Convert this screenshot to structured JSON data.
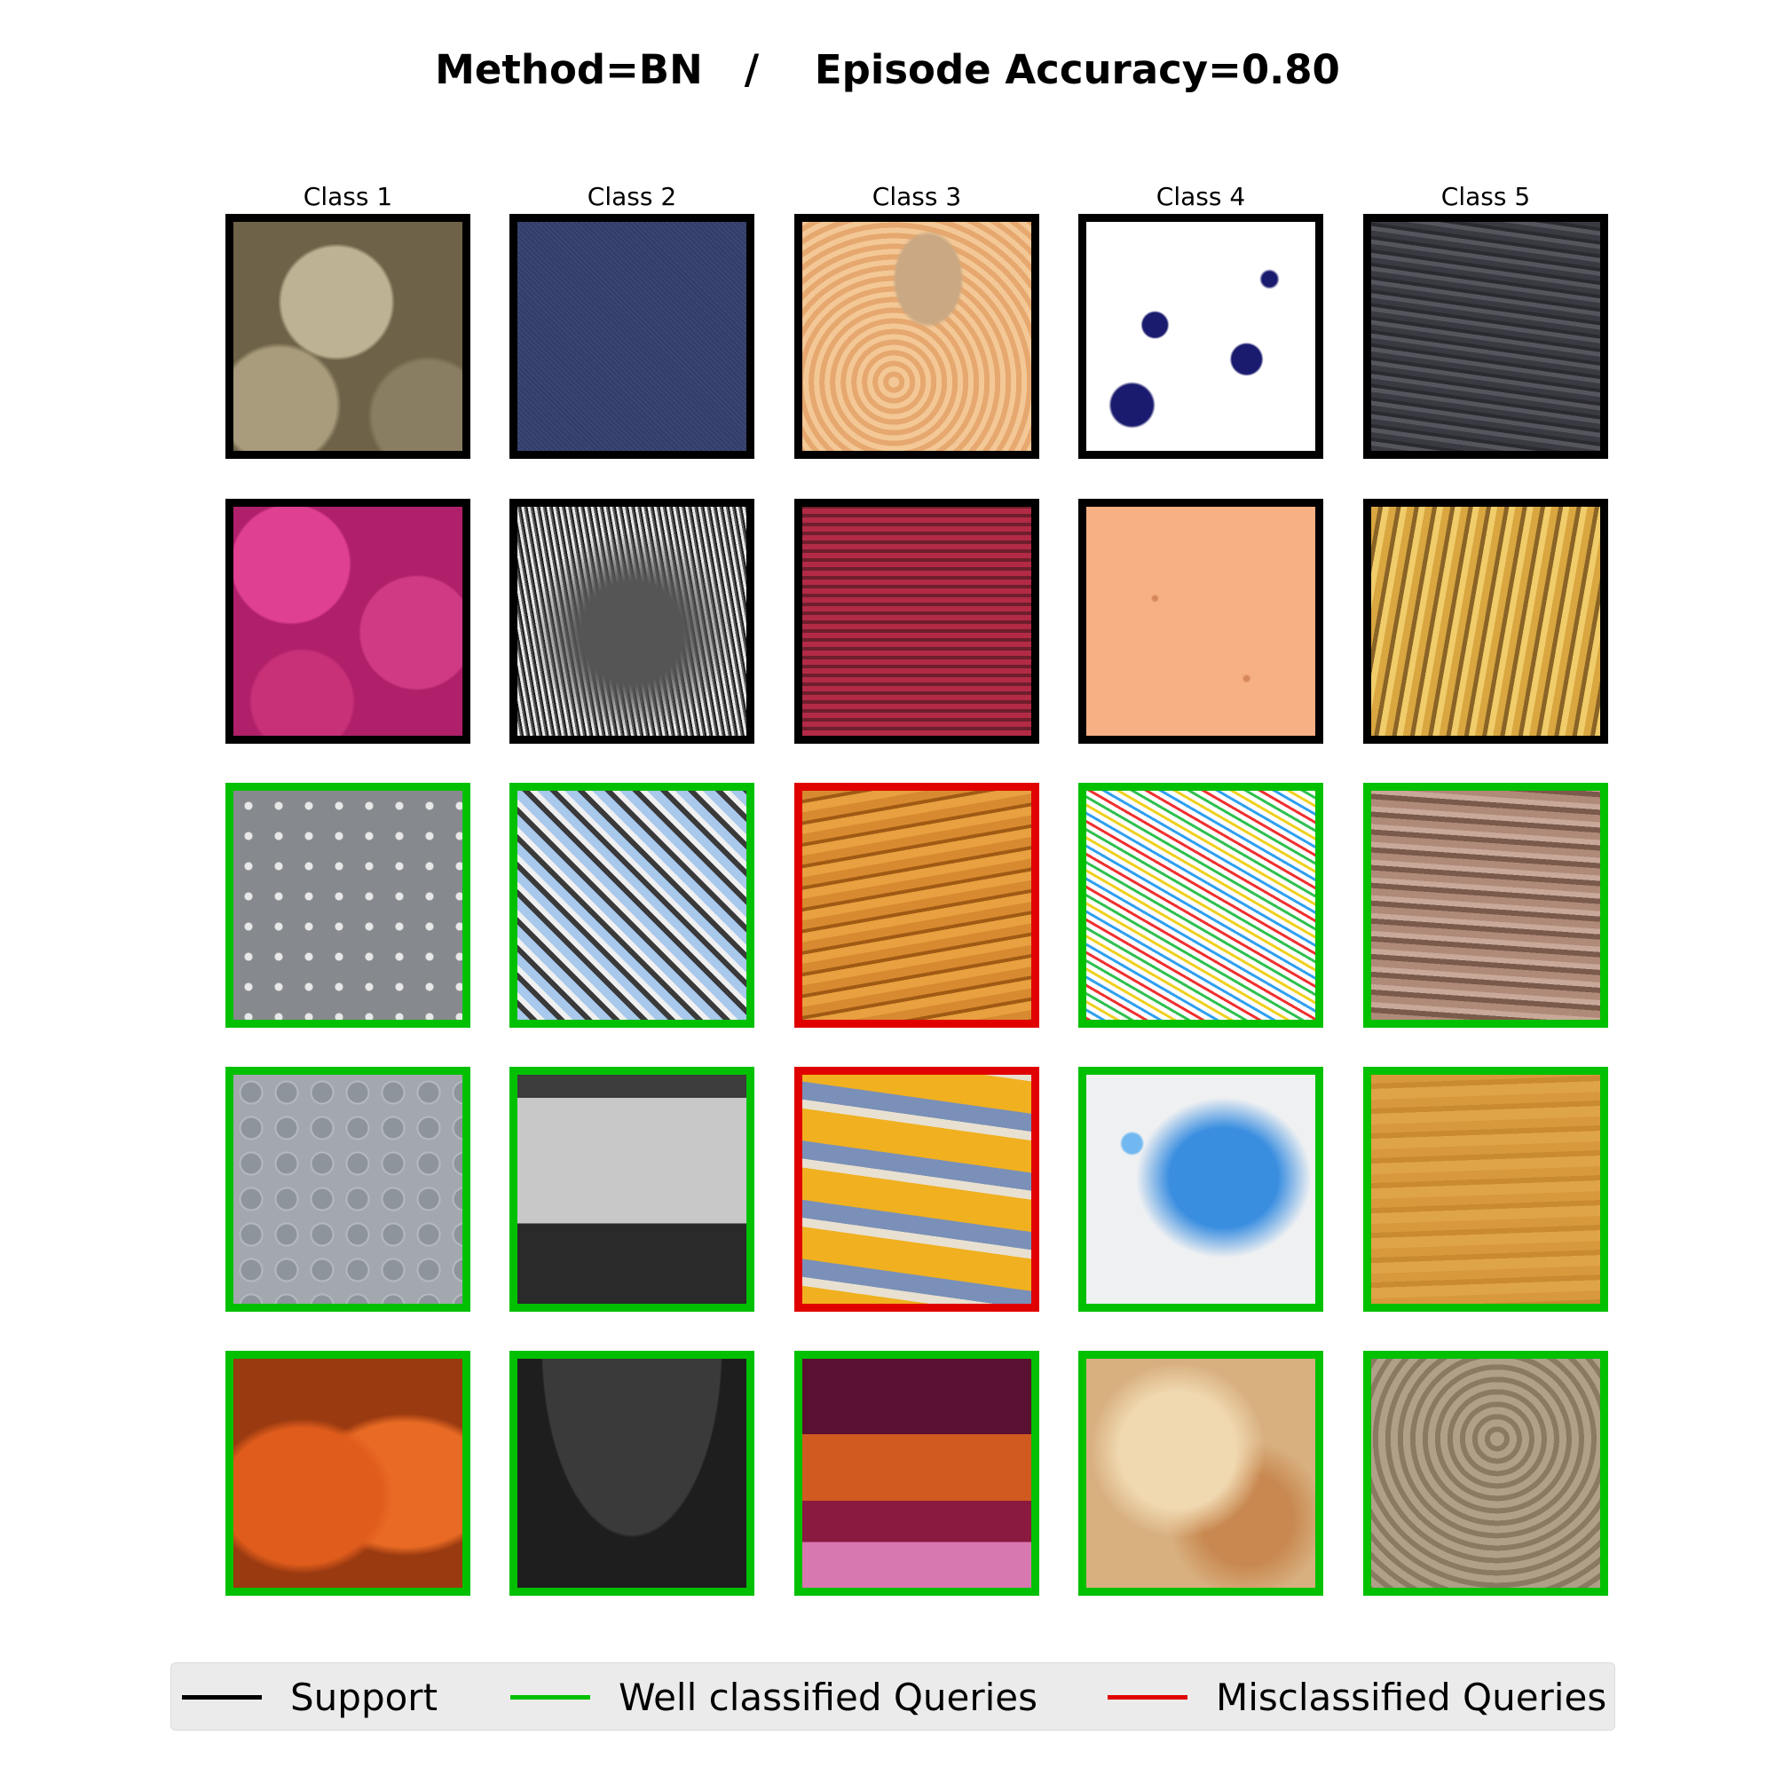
{
  "title": "Method=BN   /    Episode Accuracy=0.80",
  "columns": [
    "Class 1",
    "Class 2",
    "Class 3",
    "Class 4",
    "Class 5"
  ],
  "colors": {
    "support": "#000000",
    "well": "#00c000",
    "mis": "#e00000"
  },
  "rows": [
    {
      "role": "support",
      "status": [
        "support",
        "support",
        "support",
        "support",
        "support"
      ]
    },
    {
      "role": "support",
      "status": [
        "support",
        "support",
        "support",
        "support",
        "support"
      ]
    },
    {
      "role": "query",
      "status": [
        "well",
        "well",
        "mis",
        "well",
        "well"
      ]
    },
    {
      "role": "query",
      "status": [
        "well",
        "well",
        "mis",
        "well",
        "well"
      ]
    },
    {
      "role": "query",
      "status": [
        "well",
        "well",
        "well",
        "well",
        "well"
      ]
    }
  ],
  "textures": [
    [
      "sponge-beige",
      "denim-navy",
      "yarn-peach",
      "ink-splatter",
      "rock-slate"
    ],
    [
      "blobs-magenta",
      "lynx-grayscale",
      "knit-red-plaid",
      "speckle-peach",
      "wood-golden"
    ],
    [
      "metal-studded-gray",
      "mirror-triangles",
      "knit-orange",
      "sprinkles-donut",
      "strata-brown"
    ],
    [
      "dots-gray-grid",
      "barn-grayscale",
      "crochet-stripes",
      "paint-blue-splatter",
      "wood-pine"
    ],
    [
      "gourd-orange",
      "leather-black",
      "knit-burgundy-stripes",
      "pastry-crust",
      "wood-weathered"
    ]
  ],
  "legend": [
    {
      "key": "support",
      "label": "Support"
    },
    {
      "key": "well",
      "label": "Well classified Queries"
    },
    {
      "key": "mis",
      "label": "Misclassified Queries"
    }
  ]
}
